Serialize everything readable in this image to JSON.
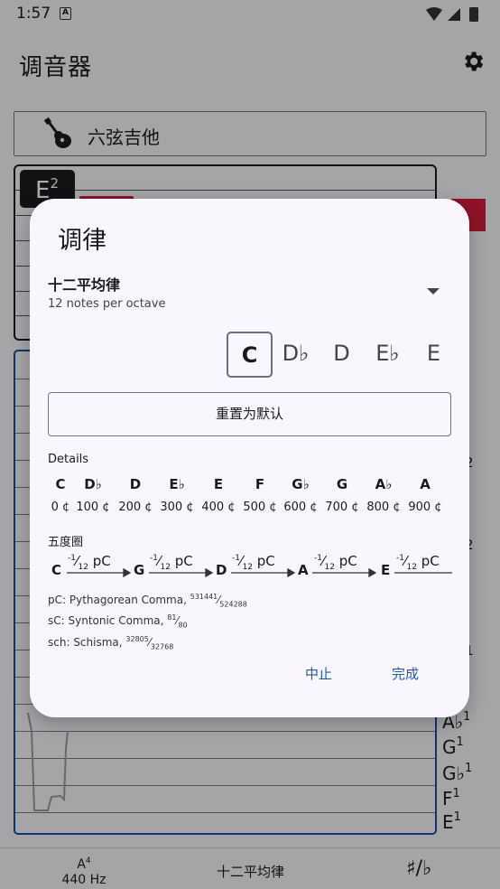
{
  "status_bar": {
    "time": "1:57",
    "notification_glyph": "A"
  },
  "app_bar": {
    "title": "调音器",
    "settings_icon": "gear-icon"
  },
  "instrument": {
    "name": "六弦吉他",
    "icon": "guitar-icon"
  },
  "string_panel": {
    "note": "E",
    "octave": "2"
  },
  "right_notes": [
    {
      "note": "A♭",
      "octave": "1"
    },
    {
      "note": "G",
      "octave": "1"
    },
    {
      "note": "G♭",
      "octave": "1"
    },
    {
      "note": "F",
      "octave": "1"
    },
    {
      "note": "E",
      "octave": "1"
    }
  ],
  "right_edge_text": [
    "2",
    "2",
    "1"
  ],
  "bottom_bar": {
    "reference_note": "A",
    "reference_octave": "4",
    "reference_frequency": "440 Hz",
    "temperament": "十二平均律",
    "accidental": "♯/♭"
  },
  "dialog": {
    "title": "调律",
    "temperament_name": "十二平均律",
    "temperament_subtitle": "12 notes per octave",
    "root_notes": [
      "C",
      "D♭",
      "D",
      "E♭",
      "E"
    ],
    "selected_root": "C",
    "reset_label": "重置为默认",
    "details_label": "Details",
    "details": [
      {
        "note": "C",
        "cents": "0 ¢"
      },
      {
        "note": "D♭",
        "cents": "100 ¢"
      },
      {
        "note": "D",
        "cents": "200 ¢"
      },
      {
        "note": "E♭",
        "cents": "300 ¢"
      },
      {
        "note": "E",
        "cents": "400 ¢"
      },
      {
        "note": "F",
        "cents": "500 ¢"
      },
      {
        "note": "G♭",
        "cents": "600 ¢"
      },
      {
        "note": "G",
        "cents": "700 ¢"
      },
      {
        "note": "A♭",
        "cents": "800 ¢"
      },
      {
        "note": "A",
        "cents": "900 ¢"
      }
    ],
    "fifths_label": "五度圈",
    "fifths_notes": [
      "C",
      "G",
      "D",
      "A",
      "E"
    ],
    "fifths_step": {
      "sign": "-",
      "num": "1",
      "den": "12",
      "unit": "pC"
    },
    "legend": [
      {
        "text": "pC: Pythagorean Comma, ",
        "num": "531441",
        "den": "524288"
      },
      {
        "text": "sC: Syntonic Comma, ",
        "num": "81",
        "den": "80"
      },
      {
        "text": "sch: Schisma, ",
        "num": "32805",
        "den": "32768"
      }
    ],
    "cancel_label": "中止",
    "done_label": "完成"
  }
}
